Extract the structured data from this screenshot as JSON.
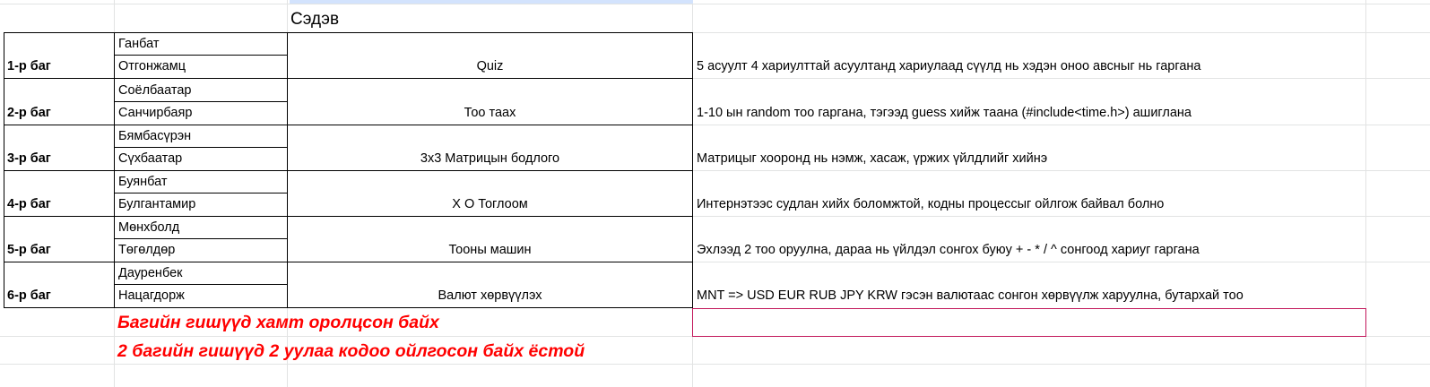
{
  "sheet": {
    "topic_header": "Сэдэв",
    "teams": [
      {
        "team": "1-р баг",
        "members": [
          "Ганбат",
          "Отгонжамц"
        ],
        "topic": "Quiz",
        "description": "5 асуулт 4 хариулттай асуултанд хариулаад сүүлд нь хэдэн оноо авсныг нь гаргана"
      },
      {
        "team": "2-р баг",
        "members": [
          "Соёлбаатар",
          "Санчирбаяр"
        ],
        "topic": "Тоо таах",
        "description": "1-10 ын random тоо гаргана, тэгээд guess хийж таана (#include<time.h>) ашиглана"
      },
      {
        "team": "3-р баг",
        "members": [
          "Бямбасүрэн",
          "Сүхбаатар"
        ],
        "topic": "3x3 Матрицын бодлого",
        "description": "Матрицыг хооронд нь нэмж, хасаж, үржих үйлдлийг хийнэ"
      },
      {
        "team": "4-р баг",
        "members": [
          "Буянбат",
          "Булгантамир"
        ],
        "topic": "X O Тоглоом",
        "description": "Интернэтээс судлан хийх боломжтой, кодны процессыг ойлгож байвал болно"
      },
      {
        "team": "5-р баг",
        "members": [
          "Мөнхболд",
          "Төгөлдөр"
        ],
        "topic": "Тооны машин",
        "description": "Эхлээд 2 тоо оруулна, дараа нь үйлдэл сонгох буюу + - * / ^ сонгоод хариуг гаргана"
      },
      {
        "team": "6-р баг",
        "members": [
          "Дауренбек",
          "Нацагдорж"
        ],
        "topic": "Валют хөрвүүлэх",
        "description": "MNT => USD EUR RUB JPY KRW гэсэн валютаас сонгон хөрвүүлж харуулна, бутархай тоо"
      }
    ],
    "notes": [
      "Багийн гишүүд хамт оролцсон байх",
      "2 багийн гишүүд 2 уулаа кодоо ойлгосон байх ёстой"
    ]
  },
  "colors": {
    "gridline": "#e2e3e3",
    "note_text": "#ff0000",
    "selection_border": "#c2185b"
  }
}
